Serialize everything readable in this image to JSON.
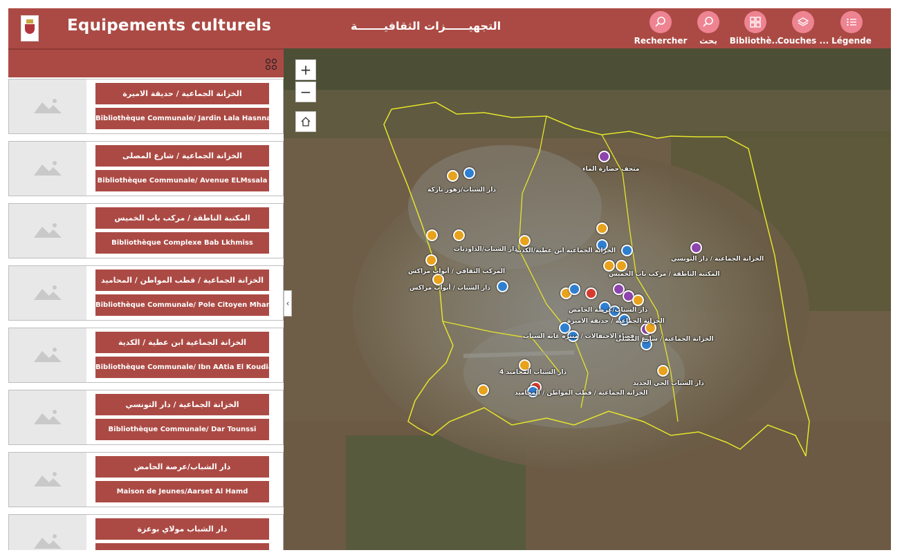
{
  "header": {
    "title": "Equipements culturels",
    "title_ar": "التجهيــــــزات الثقافيـــــــة",
    "buttons": [
      {
        "label": "Rechercher",
        "icon": "search-icon"
      },
      {
        "label": "بحث",
        "icon": "search-icon"
      },
      {
        "label": "Bibliothè...",
        "icon": "gallery-icon"
      },
      {
        "label": "Couches ...",
        "icon": "layers-icon"
      },
      {
        "label": "Légende",
        "icon": "legend-icon"
      }
    ]
  },
  "panel": {
    "cards": [
      {
        "ar": "الخزانة الجماعية / حديقة الاميرة",
        "fr": "Bibliothèque Communale/ Jardin Lala Hasnna"
      },
      {
        "ar": "الخزانة الجماعية / شارع المصلى",
        "fr": "Bibliothèque Communale/ Avenue ELMssala"
      },
      {
        "ar": "المكتبة الناطقة /  مركب باب الخميس",
        "fr": "Bibliothèque Complexe  Bab Lkhmiss"
      },
      {
        "ar": "الخزانة الجماعية / قطب المواطن / المحاميد",
        "fr": "Bibliothèque Communale/ Pole Citoyen Mhamid"
      },
      {
        "ar": "الخزانة الجماعية ابن عطية / الكدية",
        "fr": "Bibliothèque Communale/ Ibn AAtia El Koudia"
      },
      {
        "ar": "الخزانة الجماعية  / دار التونسي",
        "fr": "Bibliothèque Communale/ Dar Tounssi"
      },
      {
        "ar": "دار الشباب/عرصة الحامض",
        "fr": "Maison de Jeunes/Aarset Al Hamd"
      },
      {
        "ar": "دار الشباب مولاي بوعزة",
        "fr": ""
      }
    ]
  },
  "map": {
    "zoom_in": "+",
    "zoom_out": "−",
    "collapse": "‹",
    "labels": [
      "متحف حضارة الماء",
      "دار الشباب/زهور تاركة",
      "الخزانة الجماعية ابن عطية/الكدية",
      "دار الشباب/الداوديات",
      "الخزانة الجماعية / دار التونسي",
      "المركب الثقافي / أبواب مراكش",
      "دار الشباب / أبواب مراكش",
      "المكتبة الناطقة / مركب باب الخميس",
      "دار الشباب/عرصة الحامض",
      "الخزانة الجماعية / حديقة الاميرة",
      "فضاء الاحتفالات / منتزه غابة الشباب",
      "الخزانة الجماعية / شارع المصلى",
      "دار الشباب المحاميد 4",
      "الخزانة الجماعية / قطب المواطن / المحاميد",
      "دار الشباب الحي الجديد"
    ]
  }
}
